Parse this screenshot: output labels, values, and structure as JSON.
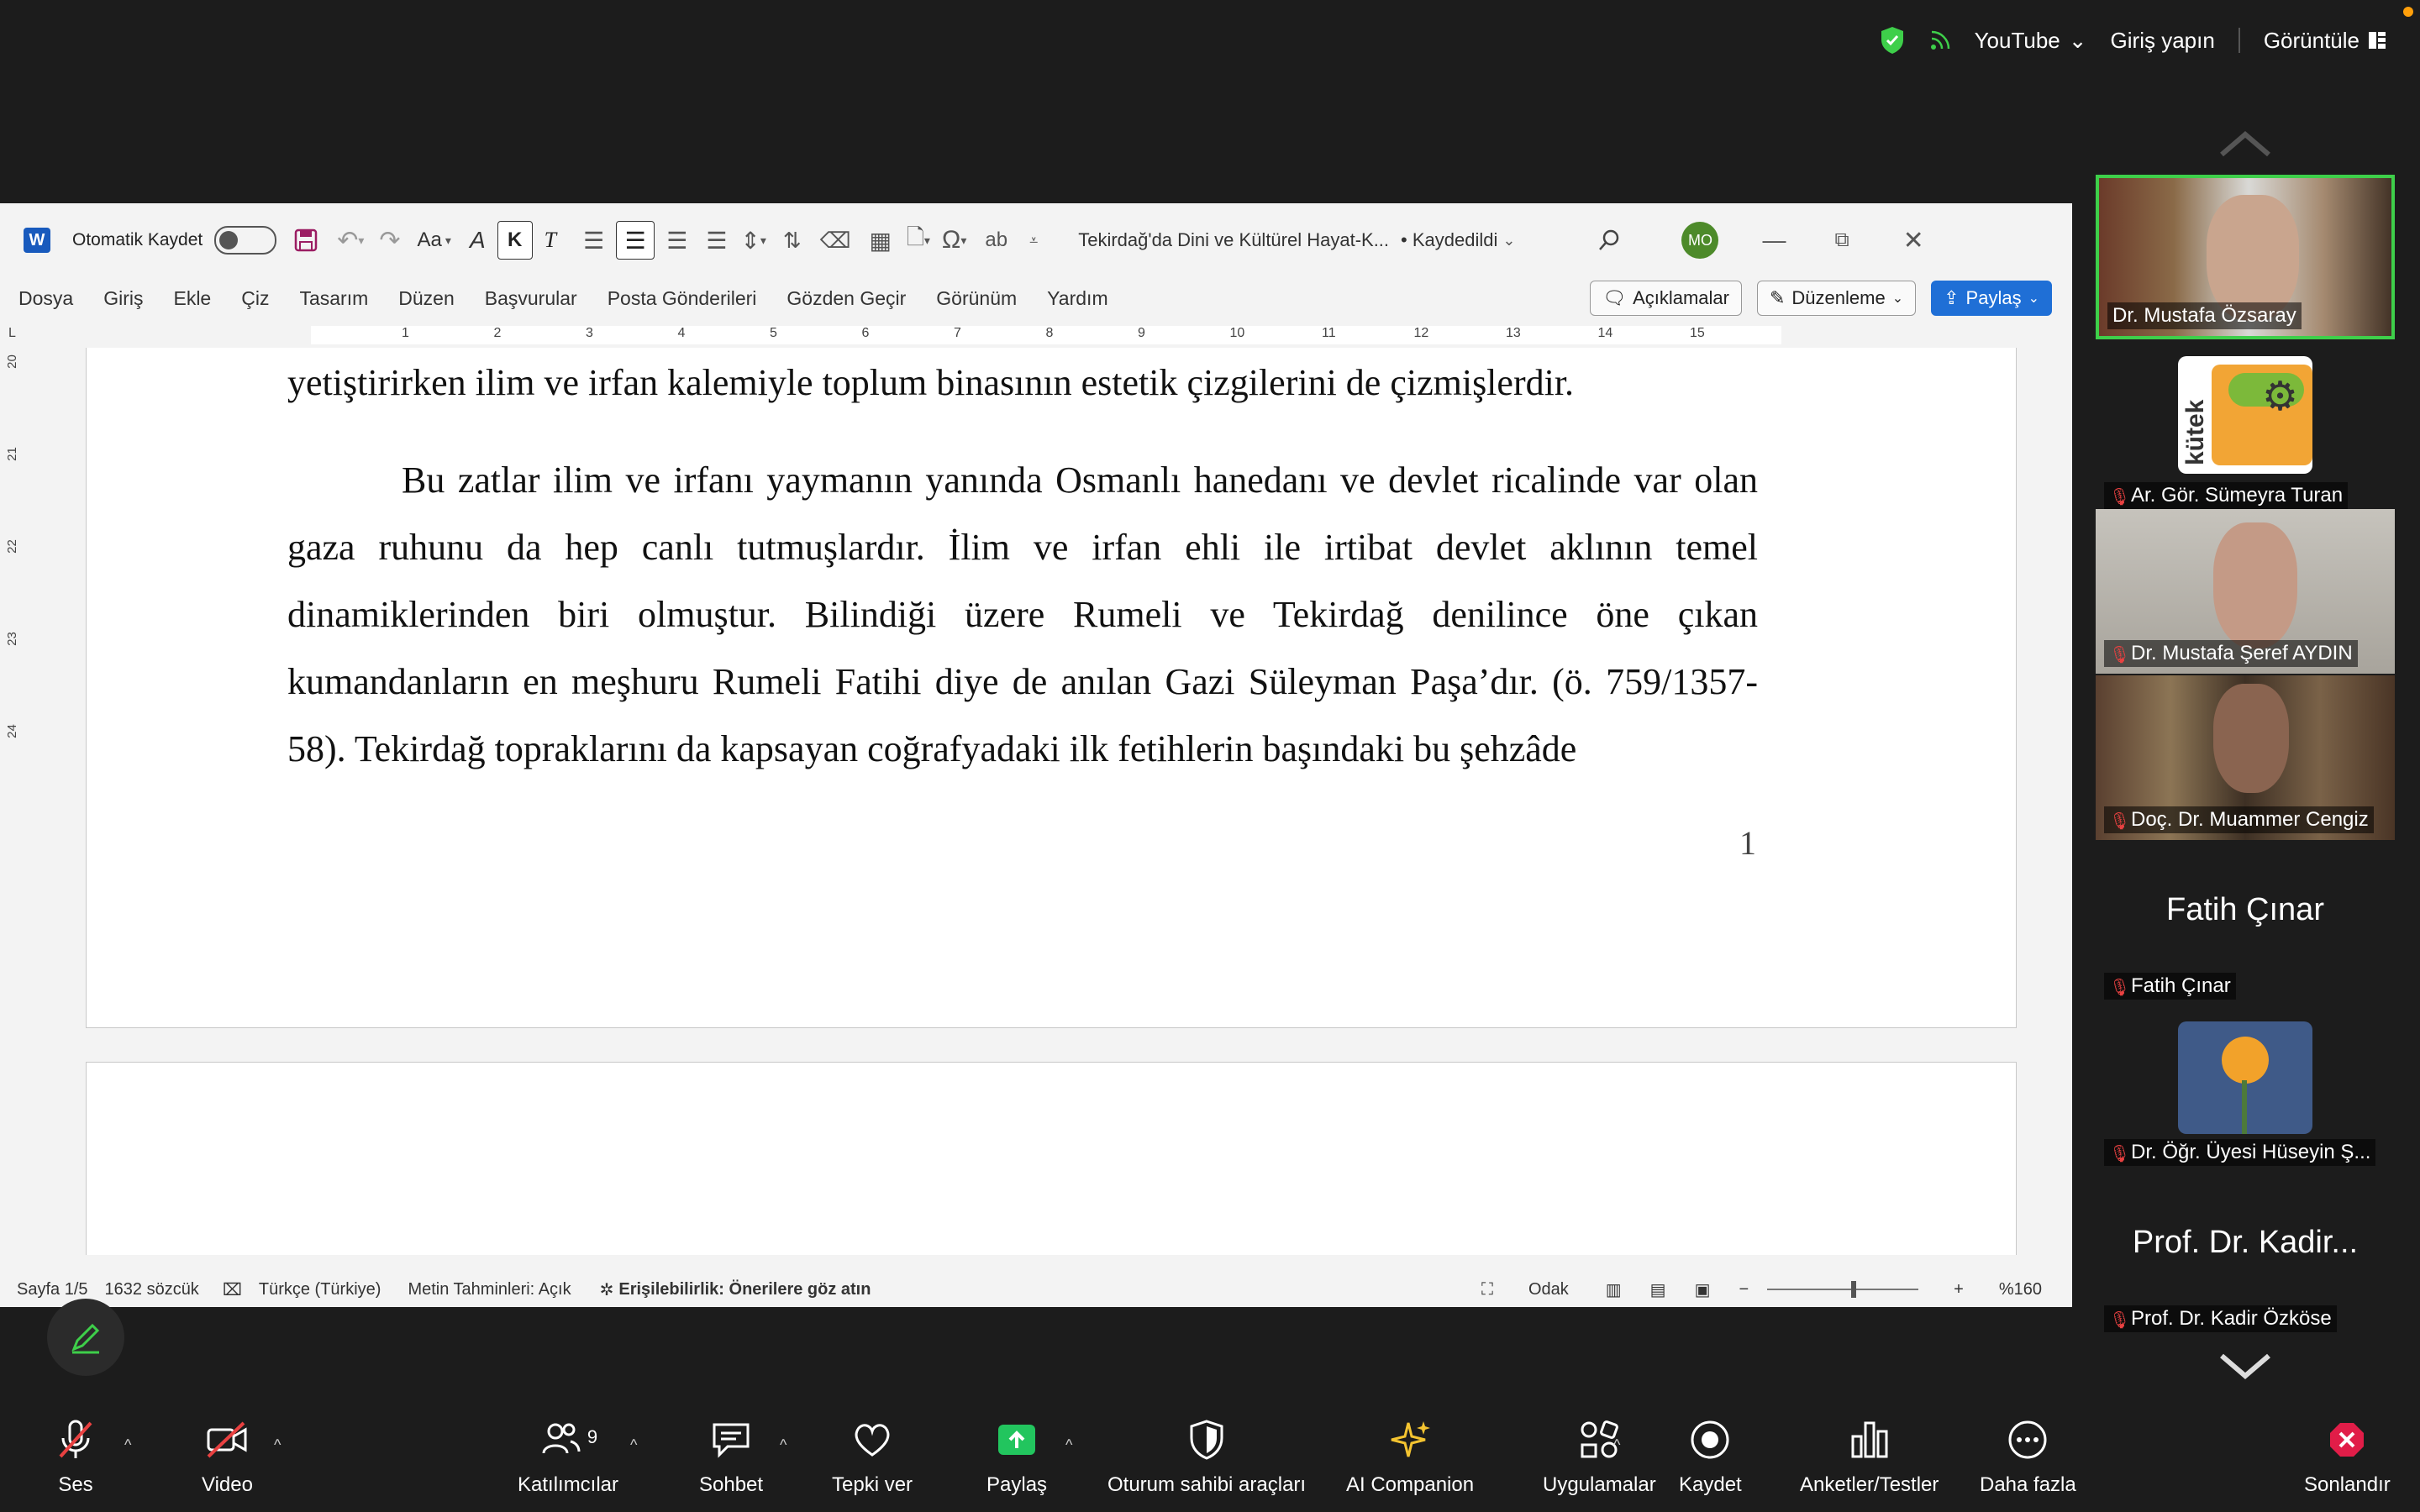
{
  "topbar": {
    "youtube_label": "YouTube",
    "signin_label": "Giriş yapın",
    "view_label": "Görüntüle",
    "accent": "#3ecf4a"
  },
  "word": {
    "autosave_label": "Otomatik Kaydet",
    "logo_letter": "W",
    "font_case_label": "Aa",
    "bold_label": "K",
    "italic_label": "T",
    "doc_title": "Tekirdağ'da Dini ve Kültürel Hayat-K...",
    "saved_label": "• Kaydedildi",
    "user_initials": "MO",
    "menu": [
      "Dosya",
      "Giriş",
      "Ekle",
      "Çiz",
      "Tasarım",
      "Düzen",
      "Başvurular",
      "Posta Gönderileri",
      "Gözden Geçir",
      "Görünüm",
      "Yardım"
    ],
    "comments_label": "Açıklamalar",
    "editing_label": "Düzenleme",
    "share_label": "Paylaş",
    "ruler_numbers": [
      "1",
      "2",
      "3",
      "4",
      "5",
      "6",
      "7",
      "8",
      "9",
      "10",
      "11",
      "12",
      "13",
      "14",
      "15"
    ],
    "vruler_numbers": [
      "20",
      "21",
      "22",
      "23",
      "24"
    ],
    "paragraph1_end": "yetiştirirken ilim ve irfan kalemiyle toplum binasının estetik çizgilerini de çizmişlerdir.",
    "paragraph2": "Bu zatlar ilim ve irfanı yaymanın yanında Osmanlı hanedanı ve devlet ricalinde var olan gaza ruhunu da hep canlı tutmuşlardır. İlim ve irfan ehli ile irtibat devlet aklının temel dinamiklerinden biri olmuştur. Bilindiği üzere Rumeli ve Tekirdağ denilince öne çıkan kumandanların en meşhuru Rumeli Fatihi diye de anılan Gazi Süleyman Paşa’dır. (ö. 759/1357-58). Tekirdağ topraklarını da kapsayan coğrafyadaki ilk fetihlerin başındaki bu şehzâde",
    "page_number": "1",
    "status": {
      "page": "Sayfa 1/5",
      "words": "1632 sözcük",
      "language": "Türkçe (Türkiye)",
      "predictions": "Metin Tahminleri: Açık",
      "accessibility": "Erişilebilirlik: Önerilere göz atın",
      "focus": "Odak",
      "zoom": "%160"
    }
  },
  "participants": [
    {
      "name": "Dr. Mustafa Özsaray",
      "active": true
    },
    {
      "name": "Ar. Gör. Sümeyra Turan",
      "muted": true
    },
    {
      "name": "Dr. Mustafa Şeref AYDIN",
      "muted": true
    },
    {
      "name": "Doç. Dr. Muammer Cengiz",
      "muted": true
    },
    {
      "name": "Fatih Çınar",
      "big": "Fatih Çınar",
      "muted": true
    },
    {
      "name": "Dr. Öğr. Üyesi Hüseyin Ş...",
      "muted": true
    },
    {
      "name": "Prof. Dr. Kadir Özköse",
      "big": "Prof. Dr. Kadir...",
      "muted": true
    }
  ],
  "logo_text": "kütek",
  "toolbar": {
    "audio": "Ses",
    "video": "Video",
    "participants": "Katılımcılar",
    "participants_count": "9",
    "chat": "Sohbet",
    "react": "Tepki ver",
    "share": "Paylaş",
    "host_tools": "Oturum sahibi araçları",
    "ai": "AI Companion",
    "apps": "Uygulamalar",
    "record": "Kaydet",
    "polls": "Anketler/Testler",
    "more": "Daha fazla",
    "end": "Sonlandır"
  }
}
